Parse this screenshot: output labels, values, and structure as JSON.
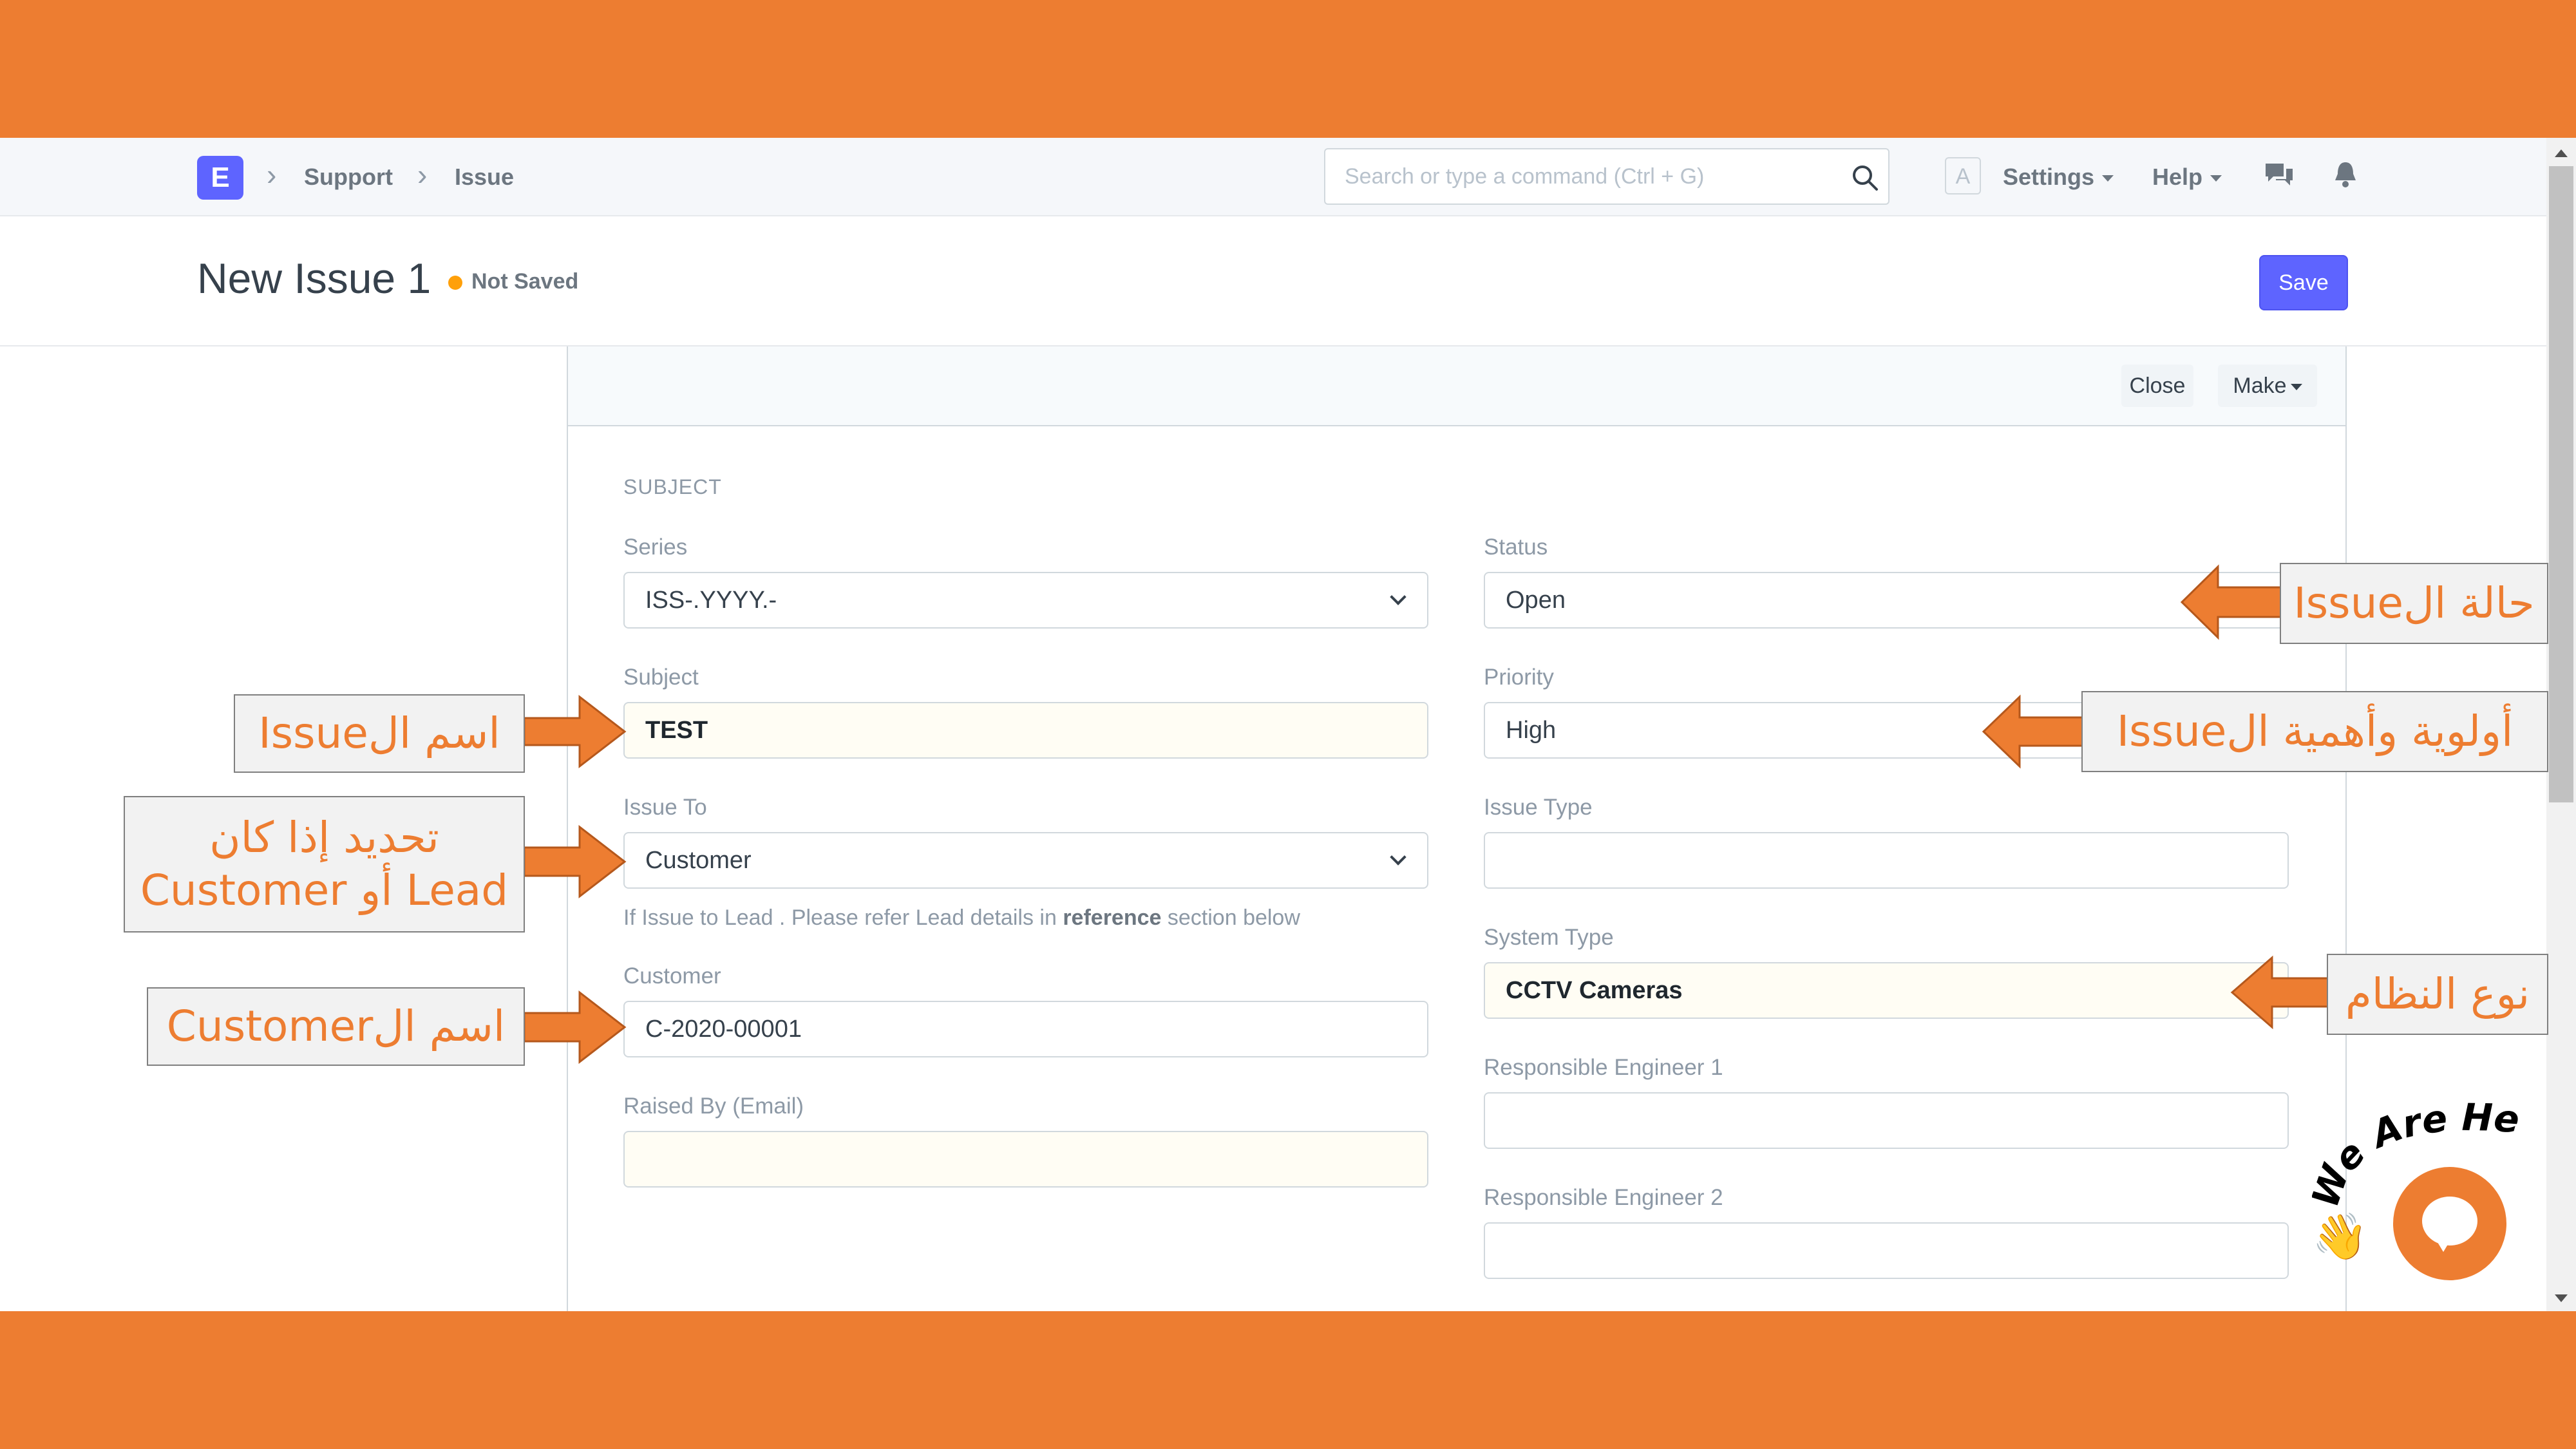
{
  "nav": {
    "logo_letter": "E",
    "breadcrumbs": [
      "Support",
      "Issue"
    ],
    "search_placeholder": "Search or type a command (Ctrl + G)",
    "avatar_letter": "A",
    "settings_label": "Settings",
    "help_label": "Help"
  },
  "header": {
    "title": "New Issue 1",
    "status": "Not Saved",
    "save_label": "Save"
  },
  "toolbar": {
    "close_label": "Close",
    "make_label": "Make"
  },
  "form": {
    "section": "SUBJECT",
    "series": {
      "label": "Series",
      "value": "ISS-.YYYY.-"
    },
    "subject": {
      "label": "Subject",
      "value": "TEST"
    },
    "issue_to": {
      "label": "Issue To",
      "value": "Customer",
      "help_prefix": "If Issue to Lead . Please refer Lead details in",
      "help_bold": "reference",
      "help_suffix": "section below"
    },
    "customer": {
      "label": "Customer",
      "value": "C-2020-00001"
    },
    "raised_by": {
      "label": "Raised By (Email)",
      "value": ""
    },
    "status": {
      "label": "Status",
      "value": "Open"
    },
    "priority": {
      "label": "Priority",
      "value": "High"
    },
    "issue_type": {
      "label": "Issue Type",
      "value": ""
    },
    "system_type": {
      "label": "System Type",
      "value": "CCTV Cameras"
    },
    "engineer1": {
      "label": "Responsible Engineer 1",
      "value": ""
    },
    "engineer2": {
      "label": "Responsible Engineer 2",
      "value": ""
    }
  },
  "annotations": {
    "issue_name": "اسم الIssue",
    "issue_to_line1": "تحديد إذا كان",
    "issue_to_line2": "Lead أو Customer",
    "customer_name": "اسم الCustomer",
    "status": "حالة الIssue",
    "priority": "أولوية وأهمية الIssue",
    "system_type": "نوع النظام"
  },
  "chat_widget": {
    "text": "We Are Here!"
  },
  "colors": {
    "brand_orange": "#ED7D31",
    "primary": "#5e64ff",
    "indicator": "#ffa00a"
  }
}
